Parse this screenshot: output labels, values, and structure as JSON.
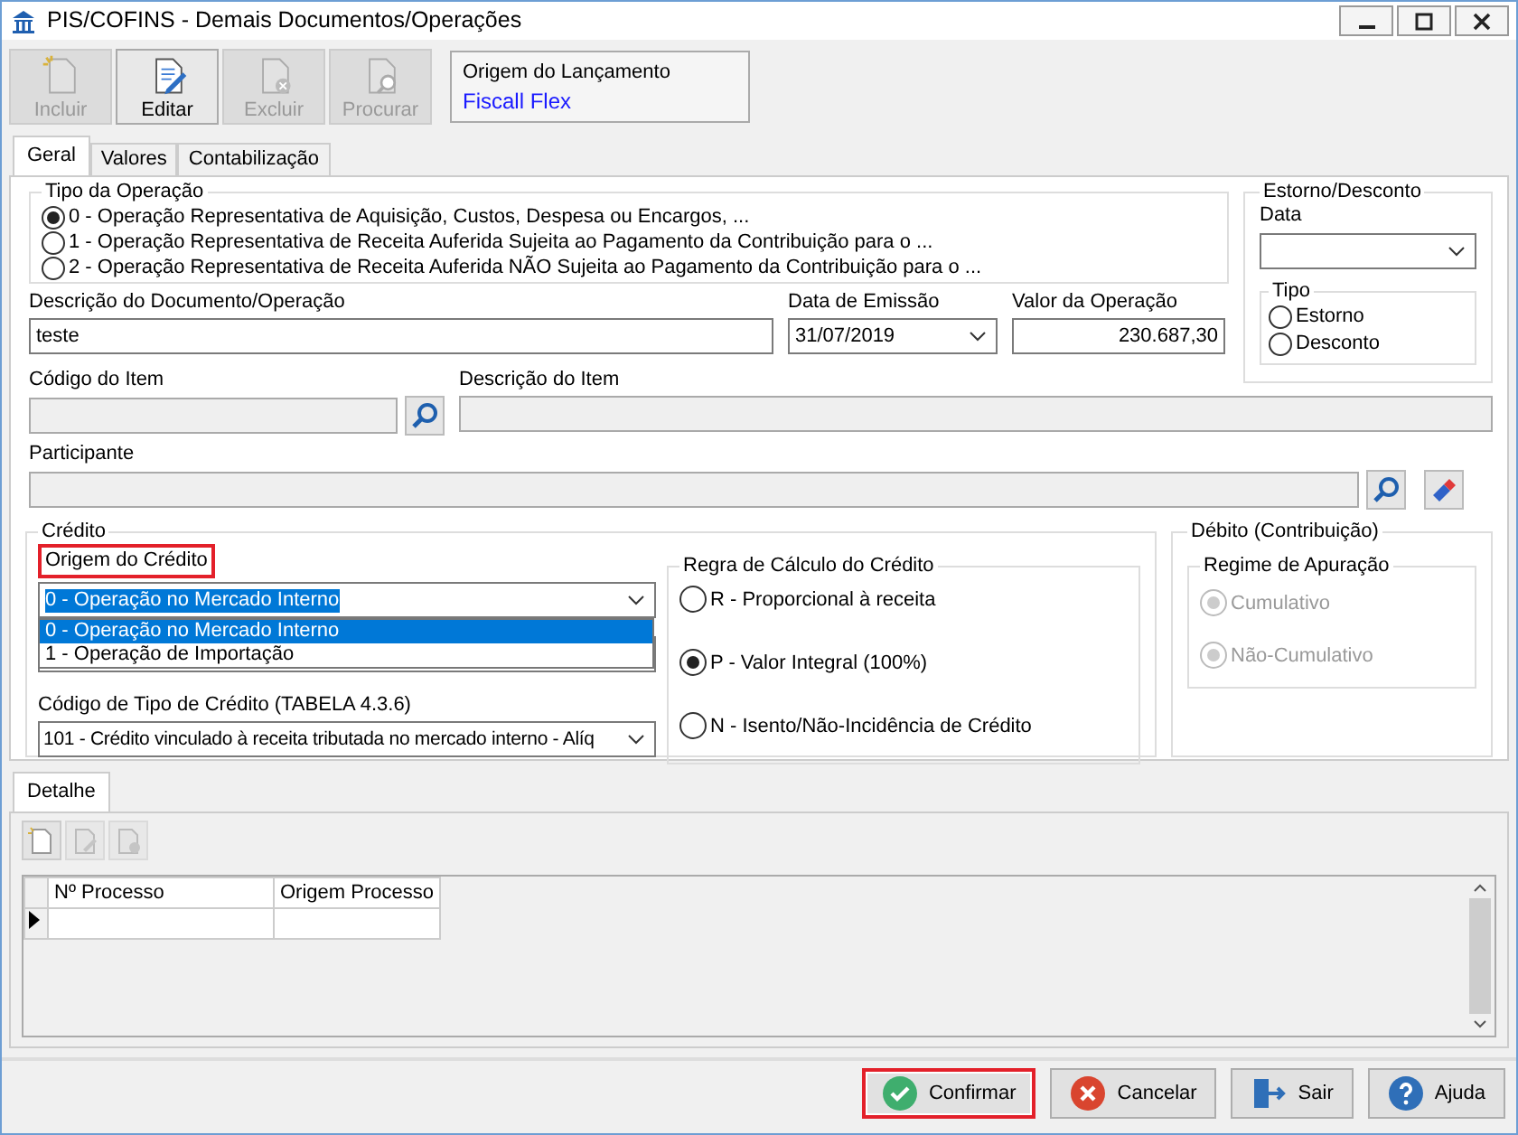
{
  "window": {
    "title": "PIS/COFINS - Demais Documentos/Operações"
  },
  "toolbar": [
    {
      "label": "Incluir",
      "kind": "new",
      "disabled": true
    },
    {
      "label": "Editar",
      "kind": "edit",
      "disabled": false
    },
    {
      "label": "Excluir",
      "kind": "delete",
      "disabled": true
    },
    {
      "label": "Procurar",
      "kind": "find",
      "disabled": true
    }
  ],
  "origin": {
    "label": "Origem do Lançamento",
    "value": "Fiscall Flex"
  },
  "tabs": [
    {
      "label": "Geral",
      "selected": true
    },
    {
      "label": "Valores",
      "selected": false
    },
    {
      "label": "Contabilização",
      "selected": false
    }
  ],
  "operation_type": {
    "title": "Tipo da Operação",
    "options": [
      {
        "label": "0 - Operação Representativa de Aquisição, Custos, Despesa ou Encargos, ...",
        "selected": true
      },
      {
        "label": "1 - Operação Representativa de Receita Auferida Sujeita ao Pagamento da Contribuição para o ...",
        "selected": false
      },
      {
        "label": "2 - Operação Representativa de Receita Auferida NÃO Sujeita ao Pagamento da Contribuição para o ...",
        "selected": false
      }
    ]
  },
  "description": {
    "label": "Descrição do Documento/Operação",
    "value": "teste"
  },
  "issue_date": {
    "label": "Data de Emissão",
    "value": "31/07/2019"
  },
  "amount": {
    "label": "Valor da Operação",
    "value": "230.687,30"
  },
  "reversal": {
    "title": "Estorno/Desconto",
    "date_label": "Data",
    "type_title": "Tipo",
    "options": [
      {
        "label": "Estorno",
        "selected": false
      },
      {
        "label": "Desconto",
        "selected": false
      }
    ]
  },
  "item_code": {
    "label": "Código do Item"
  },
  "item_description": {
    "label": "Descrição do Item"
  },
  "participant": {
    "label": "Participante"
  },
  "credit": {
    "title": "Crédito",
    "origin": {
      "label": "Origem do Crédito",
      "highlighted": true,
      "value": "0 - Operação no Mercado Interno",
      "open": true,
      "options": [
        {
          "label": "0 - Operação no Mercado Interno",
          "selected": true
        },
        {
          "label": "1 - Operação de Importação",
          "selected": false
        }
      ]
    },
    "type_code": {
      "label": "Código de Tipo de Crédito (TABELA 4.3.6)",
      "value": "101 - Crédito vinculado à receita tributada no mercado interno - Alíq"
    },
    "rule": {
      "title": "Regra de Cálculo do Crédito",
      "options": [
        {
          "label": "R - Proporcional à receita",
          "selected": false
        },
        {
          "label": "P - Valor Integral (100%)",
          "selected": true
        },
        {
          "label": "N - Isento/Não-Incidência de Crédito",
          "selected": false
        }
      ]
    }
  },
  "debit": {
    "title": "Débito (Contribuição)",
    "regime": {
      "title": "Regime de Apuração",
      "options": [
        {
          "label": "Cumulativo",
          "selected": false,
          "disabled": true
        },
        {
          "label": "Não-Cumulativo",
          "selected": false,
          "disabled": true
        }
      ]
    }
  },
  "detail_tab": {
    "label": "Detalhe",
    "selected": true
  },
  "detail_toolbar": [
    {
      "kind": "new",
      "disabled": false
    },
    {
      "kind": "edit",
      "disabled": true
    },
    {
      "kind": "delete",
      "disabled": true
    }
  ],
  "grid": {
    "columns": [
      "Nº Processo",
      "Origem Processo"
    ],
    "rows": [
      {
        "current": true
      }
    ]
  },
  "footer_buttons": [
    {
      "label": "Confirmar",
      "kind": "check",
      "highlighted": true
    },
    {
      "label": "Cancelar",
      "kind": "cancel",
      "highlighted": false
    },
    {
      "label": "Sair",
      "kind": "exit",
      "highlighted": false
    },
    {
      "label": "Ajuda",
      "kind": "help",
      "highlighted": false
    }
  ]
}
